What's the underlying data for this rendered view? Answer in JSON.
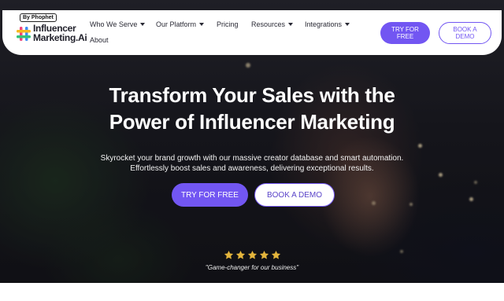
{
  "brand": {
    "badge": "By Phophet",
    "name_line1": "Influencer",
    "name_line2": "Marketing.Ai"
  },
  "nav": {
    "who_we_serve": "Who We Serve",
    "our_platform": "Our Platform",
    "pricing": "Pricing",
    "resources": "Resources",
    "integrations": "Integrations",
    "about": "About"
  },
  "header_buttons": {
    "try_line1": "TRY FOR",
    "try_line2": "FREE",
    "demo_line1": "BOOK A",
    "demo_line2": "DEMO"
  },
  "hero": {
    "headline_line1": "Transform Your Sales with the",
    "headline_line2": "Power of Influencer Marketing",
    "sub_line1": "Skyrocket your brand growth with our massive creator database and smart automation.",
    "sub_line2": "Effortlessly boost sales and awareness, delivering exceptional results.",
    "try_button": "TRY FOR FREE",
    "demo_button": "BOOK A DEMO",
    "rating_stars": 5,
    "quote": "\"Game-changer for our business\""
  },
  "colors": {
    "accent": "#7256f2",
    "star": "#e3b43c",
    "text_dark": "#1f1f29"
  },
  "icons": {
    "logo": "hashtag-logo-icon",
    "dropdown": "chevron-down-icon",
    "rating": "star-icon"
  }
}
